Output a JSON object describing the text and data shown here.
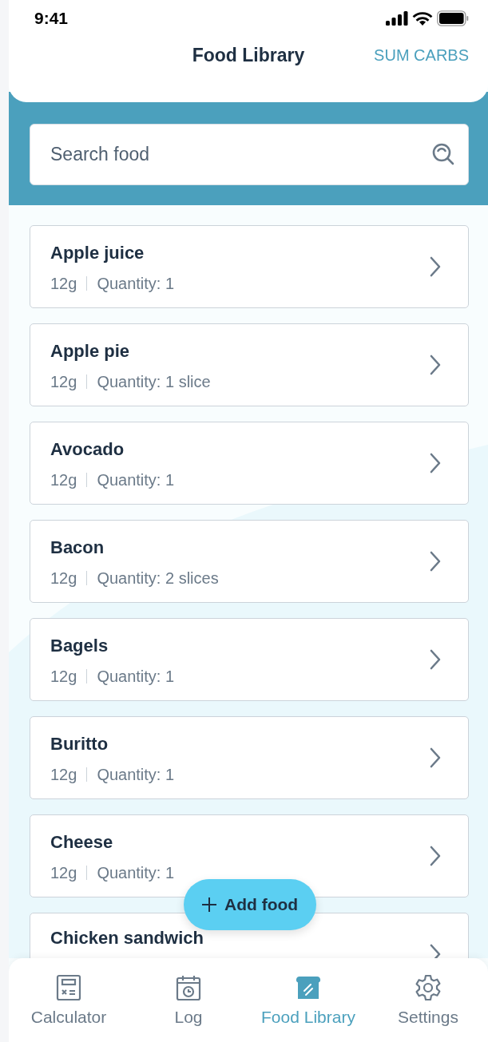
{
  "status_bar": {
    "time": "9:41"
  },
  "header": {
    "title": "Food Library",
    "action": "SUM CARBS"
  },
  "search": {
    "placeholder": "Search food"
  },
  "foods": [
    {
      "name": "Apple juice",
      "carbs": "12g",
      "quantity": "Quantity: 1"
    },
    {
      "name": "Apple pie",
      "carbs": "12g",
      "quantity": "Quantity: 1 slice"
    },
    {
      "name": "Avocado",
      "carbs": "12g",
      "quantity": "Quantity: 1"
    },
    {
      "name": "Bacon",
      "carbs": "12g",
      "quantity": "Quantity: 2 slices"
    },
    {
      "name": "Bagels",
      "carbs": "12g",
      "quantity": "Quantity: 1"
    },
    {
      "name": "Buritto",
      "carbs": "12g",
      "quantity": "Quantity: 1"
    },
    {
      "name": "Cheese",
      "carbs": "12g",
      "quantity": "Quantity: 1"
    },
    {
      "name": "Chicken sandwich"
    }
  ],
  "fab": {
    "label": "Add food"
  },
  "nav": [
    {
      "label": "Calculator",
      "selected": false
    },
    {
      "label": "Log",
      "selected": false
    },
    {
      "label": "Food Library",
      "selected": true
    },
    {
      "label": "Settings",
      "selected": false
    }
  ]
}
